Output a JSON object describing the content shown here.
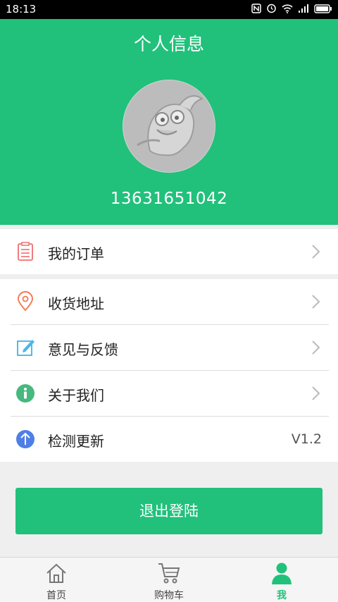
{
  "status_bar": {
    "time": "18:13"
  },
  "header": {
    "title": "个人信息",
    "phone": "13631651042"
  },
  "menu_group_1": [
    {
      "label": "我的订单",
      "icon": "order-list-icon"
    }
  ],
  "menu_group_2": [
    {
      "label": "收货地址",
      "icon": "location-pin-icon"
    },
    {
      "label": "意见与反馈",
      "icon": "edit-feedback-icon"
    },
    {
      "label": "关于我们",
      "icon": "info-icon"
    },
    {
      "label": "检测更新",
      "icon": "update-arrow-icon",
      "value": "V1.2"
    }
  ],
  "logout_label": "退出登陆",
  "tabbar": [
    {
      "label": "首页",
      "icon": "home-icon",
      "active": false
    },
    {
      "label": "购物车",
      "icon": "cart-icon",
      "active": false
    },
    {
      "label": "我",
      "icon": "user-icon",
      "active": true
    }
  ],
  "colors": {
    "primary": "#21c17b",
    "background": "#efefef"
  }
}
